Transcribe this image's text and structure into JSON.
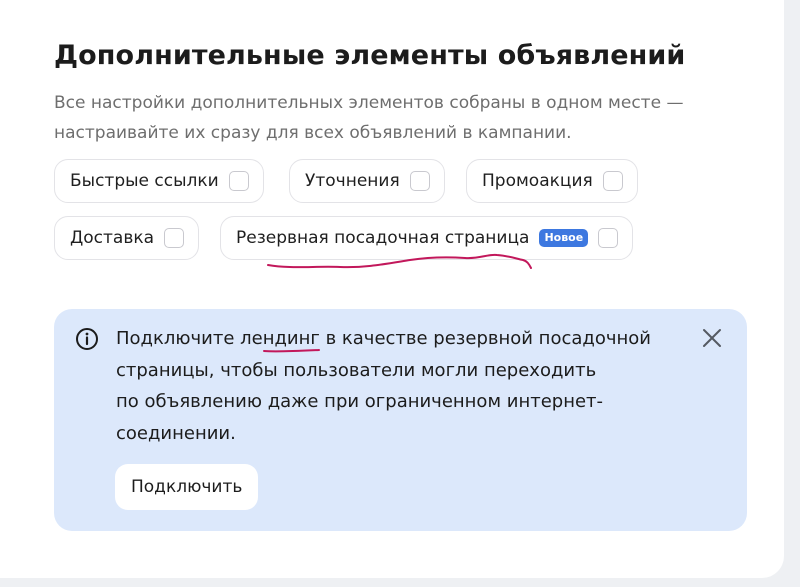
{
  "section": {
    "title": "Дополнительные элементы объявлений",
    "subtitle_line1": "Все настройки дополнительных элементов собраны в одном месте —",
    "subtitle_line2": "настраивайте их сразу для всех объявлений в кампании."
  },
  "chips": [
    {
      "label": "Быстрые ссылки",
      "checked": false
    },
    {
      "label": "Уточнения",
      "checked": false
    },
    {
      "label": "Промоакция",
      "checked": false
    },
    {
      "label": "Доставка",
      "checked": false
    },
    {
      "label": "Резервная посадочная страница",
      "badge": "Новое",
      "checked": false
    }
  ],
  "alert": {
    "icon": "info-icon",
    "line1": "Подключите лендинг в качестве резервной посадочной",
    "line2": "страницы, чтобы пользователи могли переходить",
    "line3": "по объявлению даже при ограниченном интернет-",
    "line4": "соединении.",
    "button_label": "Подключить",
    "close_icon": "close-icon"
  },
  "colors": {
    "alert_background": "#dce8fb",
    "badge": "#3d78e0",
    "annotation": "#c2185b"
  }
}
